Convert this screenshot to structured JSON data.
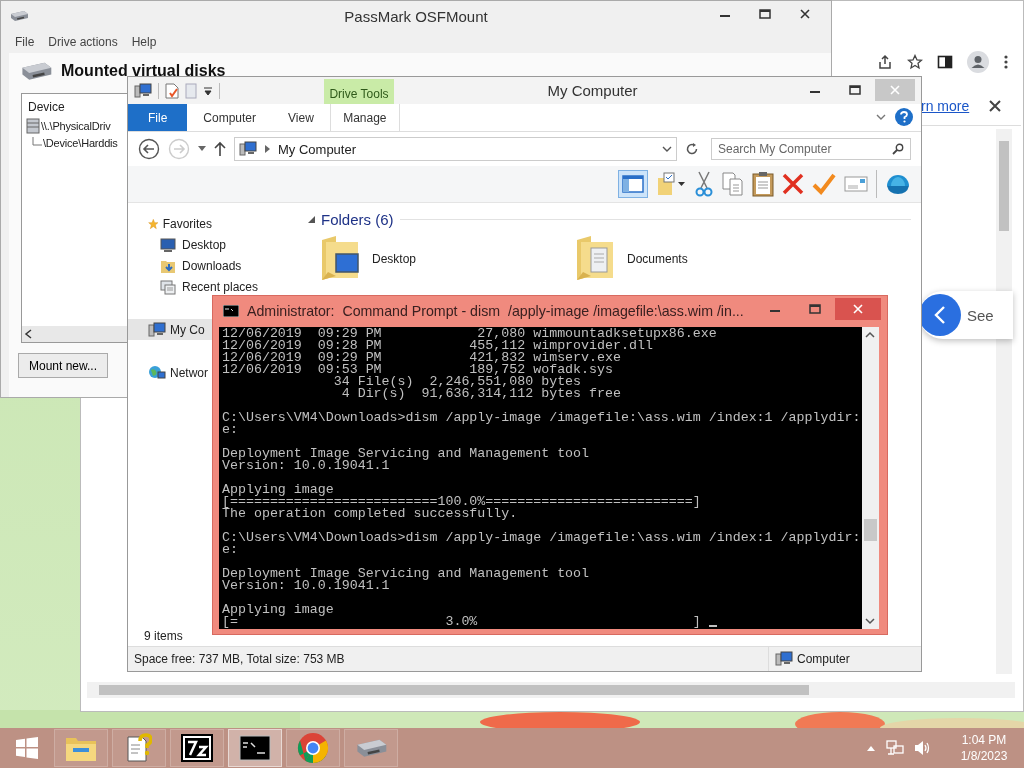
{
  "osfmount": {
    "title": "PassMark OSFMount",
    "menu": [
      "File",
      "Drive actions",
      "Help"
    ],
    "heading": "Mounted virtual disks",
    "list": {
      "column": "Device",
      "rows": [
        {
          "text": "\\\\.\\PhysicalDriv",
          "children": [
            {
              "text": "\\Device\\Harddis"
            }
          ]
        }
      ]
    },
    "buttons": [
      "Mount new..."
    ]
  },
  "browser": {
    "link": "rn more",
    "side_button": "See"
  },
  "explorer": {
    "title": "My Computer",
    "context_tab": "Drive Tools",
    "tabs": [
      {
        "label": "File",
        "selected": true
      },
      {
        "label": "Computer",
        "selected": false
      },
      {
        "label": "View",
        "selected": false
      },
      {
        "label": "Manage",
        "selected": false
      }
    ],
    "address": "My Computer",
    "search": {
      "placeholder": "Search My Computer"
    },
    "nav": [
      {
        "label": "Favorites",
        "kind": "star",
        "selected": false,
        "children": [
          {
            "label": "Desktop",
            "kind": "desktop",
            "selected": false
          },
          {
            "label": "Downloads",
            "kind": "downloads",
            "selected": false
          },
          {
            "label": "Recent places",
            "kind": "recent",
            "selected": false
          }
        ]
      },
      {
        "label": "My Co",
        "kind": "computer",
        "selected": true
      },
      {
        "label": "Networ",
        "kind": "network",
        "selected": false
      }
    ],
    "section": "Folders (6)",
    "folders": [
      {
        "name": "Desktop",
        "kind": "desktop"
      },
      {
        "name": "Documents",
        "kind": "documents"
      }
    ],
    "status": {
      "items": "9 items",
      "space": "Space free: 737 MB, Total size: 753 MB",
      "location": "Computer"
    }
  },
  "console": {
    "title": "Administrator:  Command Prompt - dism  /apply-image /imagefile:\\ass.wim /in...",
    "blocks": [
      [
        "12/06/2019  09:29 PM            27,080 wimmountadksetupx86.exe",
        "12/06/2019  09:28 PM           455,112 wimprovider.dll",
        "12/06/2019  09:29 PM           421,832 wimserv.exe",
        "12/06/2019  09:53 PM           189,752 wofadk.sys",
        "              34 File(s)  2,246,551,080 bytes",
        "               4 Dir(s)  91,636,314,112 bytes free"
      ],
      [
        "C:\\Users\\VM4\\Downloads>dism /apply-image /imagefile:\\ass.wim /index:1 /applydir:",
        "e:"
      ],
      [
        "Deployment Image Servicing and Management tool",
        "Version: 10.0.19041.1"
      ],
      [
        "Applying image",
        "[==========================100.0%==========================]",
        "The operation completed successfully."
      ],
      [
        "C:\\Users\\VM4\\Downloads>dism /apply-image /imagefile:\\ass.wim /index:1 /applydir:",
        "e:"
      ],
      [
        "Deployment Image Servicing and Management tool",
        "Version: 10.0.19041.1"
      ],
      [
        "Applying image",
        "[=                          3.0%                           ]"
      ]
    ]
  },
  "taskbar": {
    "apps": [
      {
        "kind": "explorer",
        "active": false
      },
      {
        "kind": "help",
        "active": false
      },
      {
        "kind": "sevenzip",
        "active": false
      },
      {
        "kind": "console",
        "active": true
      },
      {
        "kind": "chrome",
        "active": false
      },
      {
        "kind": "drive",
        "active": false
      }
    ],
    "time": "1:04 PM",
    "date": "1/8/2023"
  }
}
